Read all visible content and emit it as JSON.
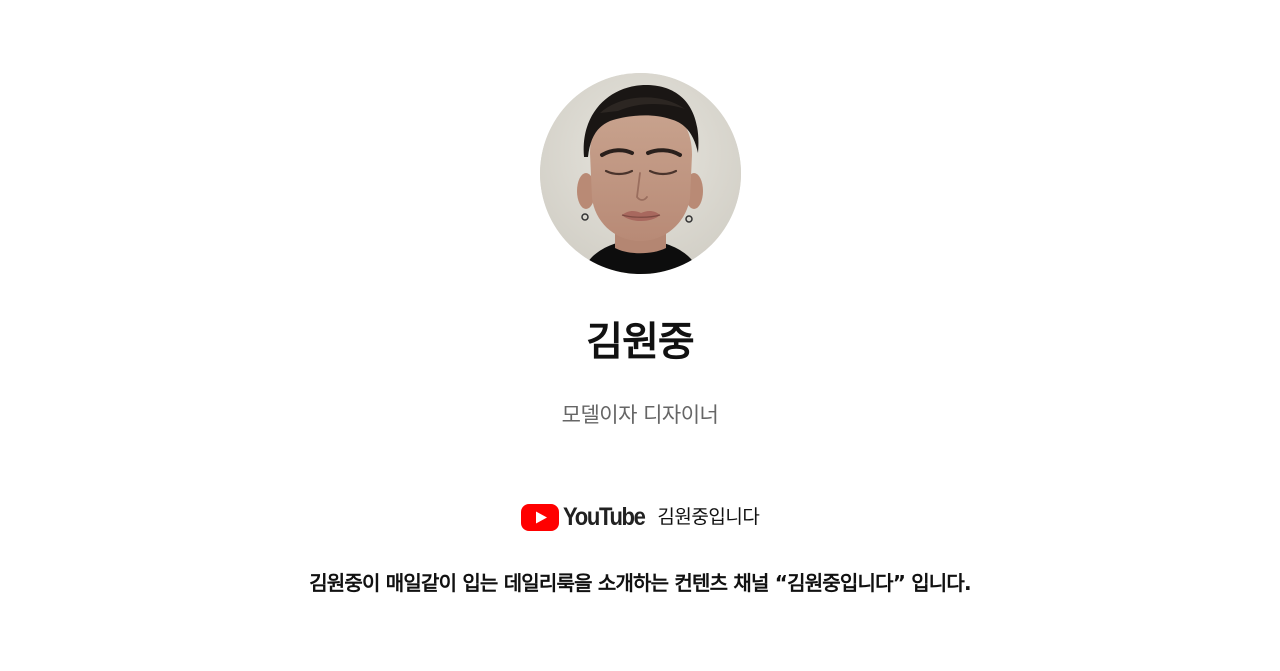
{
  "profile": {
    "name": "김원중",
    "role": "모델이자 디자이너",
    "avatar_alt": "김원중"
  },
  "channel": {
    "platform": "YouTube",
    "platform_icon": "youtube-play-icon",
    "brand_color": "#FF0000",
    "name": "김원중입니다"
  },
  "description": "김원중이 매일같이 입는 데일리룩을 소개하는 컨텐츠 채널 “김원중입니다” 입니다."
}
